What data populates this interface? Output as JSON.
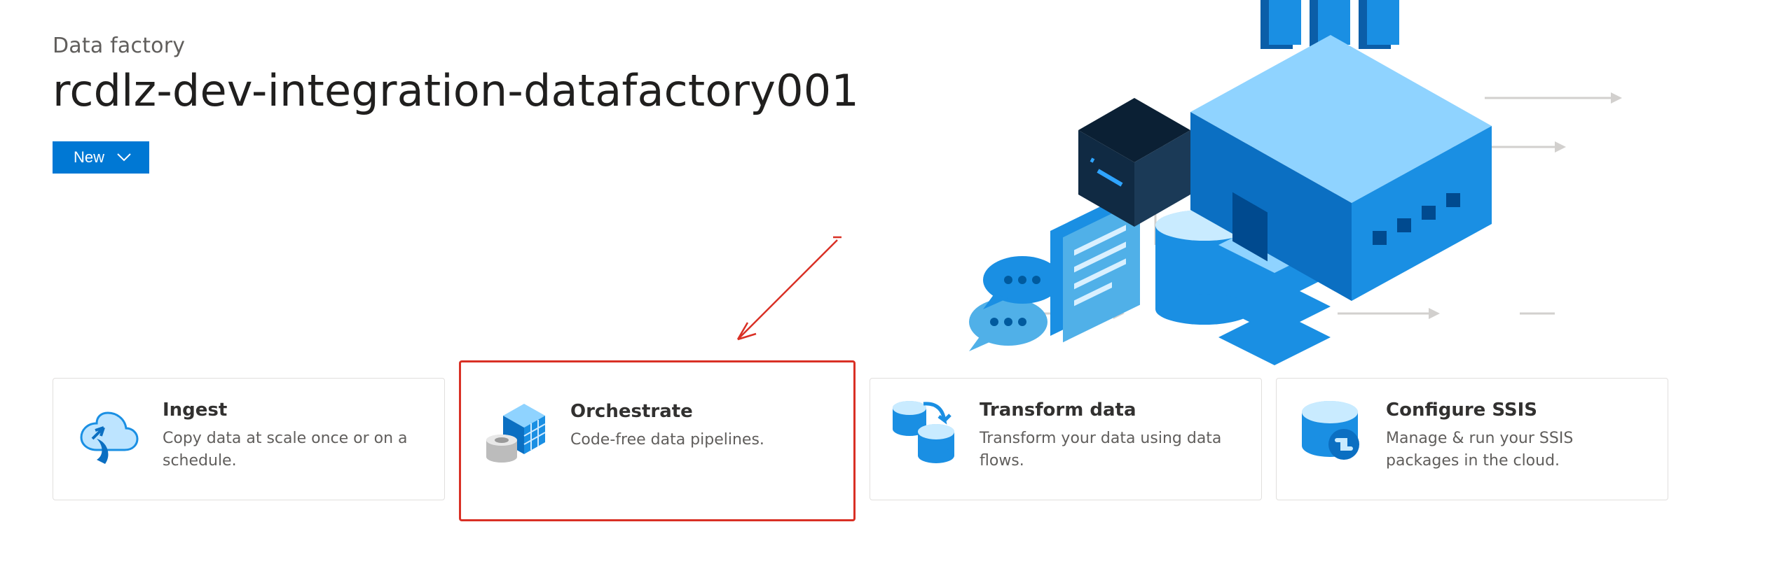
{
  "header": {
    "kicker": "Data factory",
    "title": "rcdlz-dev-integration-datafactory001",
    "new_button_label": "New"
  },
  "cards": [
    {
      "icon": "cloud-upload-icon",
      "title": "Ingest",
      "description": "Copy data at scale once or on a schedule.",
      "highlighted": false
    },
    {
      "icon": "cube-grid-icon",
      "title": "Orchestrate",
      "description": "Code-free data pipelines.",
      "highlighted": true
    },
    {
      "icon": "database-transform-icon",
      "title": "Transform data",
      "description": "Transform your data using data flows.",
      "highlighted": false
    },
    {
      "icon": "database-ssis-icon",
      "title": "Configure SSIS",
      "description": "Manage & run your SSIS packages in the cloud.",
      "highlighted": false
    }
  ],
  "annotation": {
    "type": "arrow",
    "color": "#d93025"
  }
}
